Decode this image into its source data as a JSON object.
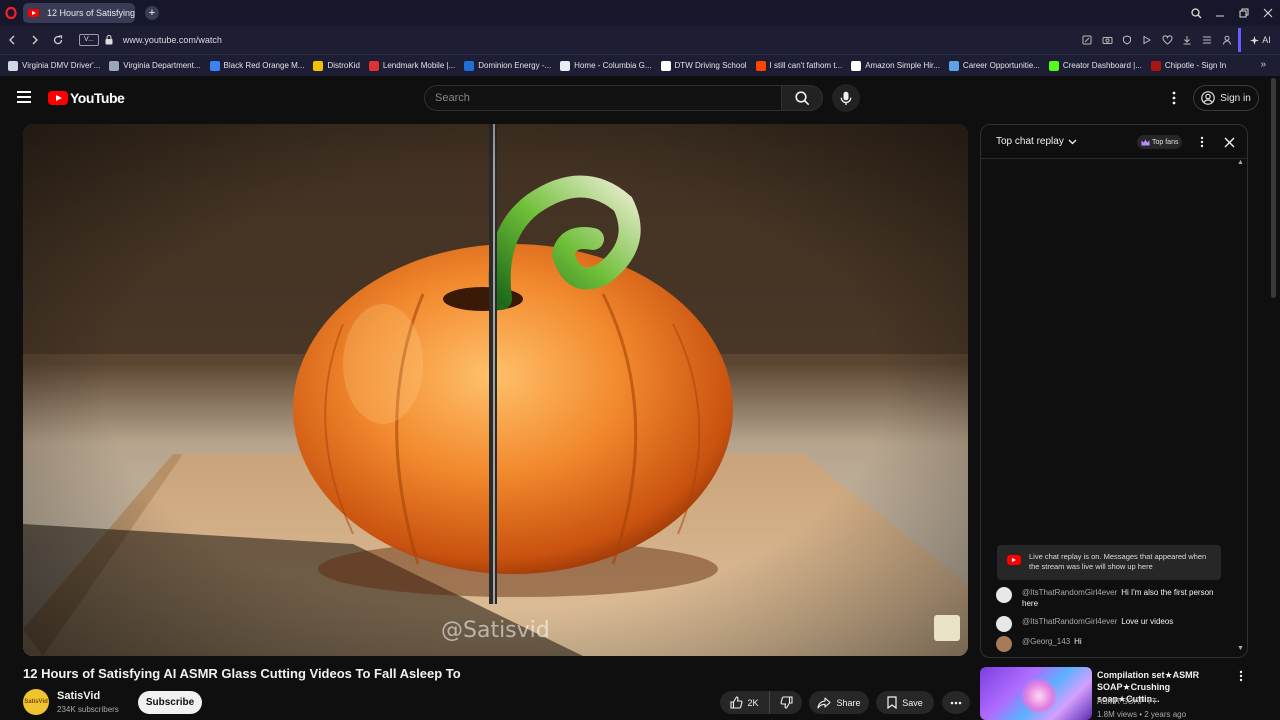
{
  "browser": {
    "tab_title": "12 Hours of Satisfying",
    "url": "www.youtube.com/watch",
    "site_badge": "V...",
    "ai_label": "AI",
    "bookmarks": [
      {
        "label": "Virginia DMV Driver'...",
        "color": "#cfd8e3"
      },
      {
        "label": "Virginia Department...",
        "color": "#9aa7b8"
      },
      {
        "label": "Black Red Orange M...",
        "color": "#3b82f6"
      },
      {
        "label": "DistroKid",
        "color": "#f2c200"
      },
      {
        "label": "Lendmark Mobile |...",
        "color": "#d33"
      },
      {
        "label": "Dominion Energy -...",
        "color": "#1e6fd9"
      },
      {
        "label": "Home - Columbia G...",
        "color": "#e8eef7"
      },
      {
        "label": "DTW Driving School",
        "color": "#ffffff"
      },
      {
        "label": "I still can't fathom t...",
        "color": "#ff4500"
      },
      {
        "label": "Amazon Simple Hir...",
        "color": "#ffffff"
      },
      {
        "label": "Career Opportunitie...",
        "color": "#5ba3e6"
      },
      {
        "label": "Creator Dashboard |...",
        "color": "#53fc18"
      },
      {
        "label": "Chipotle - Sign In",
        "color": "#a81612"
      }
    ]
  },
  "header": {
    "logo_text": "YouTube",
    "search_placeholder": "Search",
    "signin_label": "Sign in"
  },
  "video": {
    "title": "12 Hours of Satisfying AI ASMR Glass Cutting Videos To Fall Asleep To",
    "watermark": "@Satisvid",
    "channel_name": "SatisVid",
    "channel_avatar_text": "SatisVid",
    "subscribers": "234K subscribers",
    "subscribe_label": "Subscribe",
    "like_count": "2K",
    "share_label": "Share",
    "save_label": "Save"
  },
  "chat": {
    "title": "Top chat replay",
    "top_fans_label": "Top fans",
    "replay_notice": "Live chat replay is on. Messages that appeared when the stream was live will show up here",
    "messages": [
      {
        "author": "@ItsThatRandomGirl4ever",
        "text": "Hi I'm also the first person here"
      },
      {
        "author": "@ItsThatRandomGirl4ever",
        "text": "Love ur videos"
      },
      {
        "author": "@Georg_143",
        "text": "Hi"
      }
    ]
  },
  "recommendation": {
    "title": "Compilation set★ASMR SOAP★Crushing soap★Cuttin...",
    "channel": "ASMR SOAP YT",
    "meta": "1.8M views • 2 years ago"
  },
  "colors": {
    "background": "#0f0f0f",
    "brand_red": "#ff0000",
    "browser_chrome": "#1d1e33"
  }
}
